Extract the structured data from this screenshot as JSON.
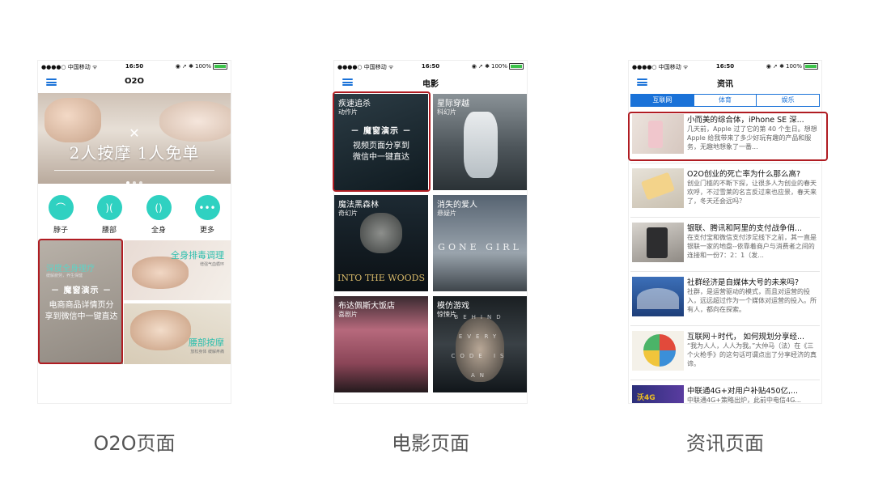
{
  "status_bar": {
    "carrier": "●●●●○ 中国移动 ᯤ",
    "time": "16:50",
    "battery": "100%",
    "battery_level": 1.0,
    "icons": "◉ ➚ ✱"
  },
  "phones": {
    "o2o": {
      "title": "O2O",
      "banner": {
        "close_symbol": "✕",
        "text": "2人按摩 1人免单"
      },
      "categories": [
        {
          "label": "脖子",
          "icon": "neck-icon",
          "glyph": "⌒"
        },
        {
          "label": "腰部",
          "icon": "waist-icon",
          "glyph": ")("
        },
        {
          "label": "全身",
          "icon": "body-icon",
          "glyph": "()"
        },
        {
          "label": "更多",
          "icon": "more-icon",
          "glyph": "•••"
        }
      ],
      "promo_left": {
        "title": "深度全身理疗",
        "sub": "缓解疲劳，养生保健"
      },
      "promo_right_top": {
        "title": "全身排毒调理",
        "sub": "增强气血循环"
      },
      "promo_right_bottom": {
        "title": "腰部按摩",
        "sub": "放松身体 缓解疼痛"
      },
      "demo": {
        "heading": "－ 魔窗演示 －",
        "line1": "电商商品详情页分",
        "line2": "享到微信中一键直达"
      }
    },
    "movie": {
      "title": "电影",
      "movies": [
        {
          "title": "疾速追杀",
          "genre": "动作片",
          "art": ""
        },
        {
          "title": "星际穿越",
          "genre": "科幻片",
          "art": ""
        },
        {
          "title": "魔法黑森林",
          "genre": "奇幻片",
          "art": "INTO THE WOODS"
        },
        {
          "title": "消失的爱人",
          "genre": "悬疑片",
          "art": "GONE GIRL"
        },
        {
          "title": "布达佩斯大饭店",
          "genre": "喜剧片",
          "art": ""
        },
        {
          "title": "模仿游戏",
          "genre": "惊悚片",
          "art": "BEHIND EVERY CODE IS AN"
        }
      ],
      "demo": {
        "heading": "－ 魔窗演示 －",
        "line1": "视频页面分享到",
        "line2": "微信中一键直达"
      }
    },
    "news": {
      "title": "资讯",
      "tabs": [
        "互联网",
        "体育",
        "娱乐"
      ],
      "active_tab": 0,
      "items": [
        {
          "title": "小而美的综合体，iPhone SE 深...",
          "desc": "几天前，Apple 过了它的第 40 个生日。想想 Apple 给我带来了多少好玩有趣的产品和服务，无趣地想象了一番..."
        },
        {
          "title": "O2O创业的死亡率为什么那么高?",
          "desc": "创业门槛的不断下探，让很多人为创业的春天欢呼，不过雪莱的名言反过来也应景，春天来了，冬天还会远吗？"
        },
        {
          "title": "银联、腾讯和阿里的支付战争俏...",
          "desc": "在支付宝和微信支付涉足线下之前，其一直是银联一家的地盘--依靠着商户与消费者之间的连接和一份7：2：1（发..."
        },
        {
          "title": "社群经济是自媒体大号的未来吗?",
          "desc": "社群，是运营驱动的模式，而且对运营的投入，远远超过作为一个媒体对运营的投入。所有人，都向在探索。"
        },
        {
          "title": "互联网＋时代， 如何规划分享经...",
          "desc": "“我为人人，人人为我。”大仲马（法）在《三个火枪手》的这句话可谓点出了分享经济的真谛。"
        },
        {
          "title": "中联通4G+对用户补贴450亿,...",
          "desc": "中联通4G+策略出炉，此前中电信4G..."
        }
      ]
    }
  },
  "captions": {
    "o2o": "O2O页面",
    "movie": "电影页面",
    "news": "资讯页面"
  },
  "colors": {
    "accent_blue": "#1a72d8",
    "teal": "#2fd1c1",
    "highlight_red": "#b01c22"
  }
}
